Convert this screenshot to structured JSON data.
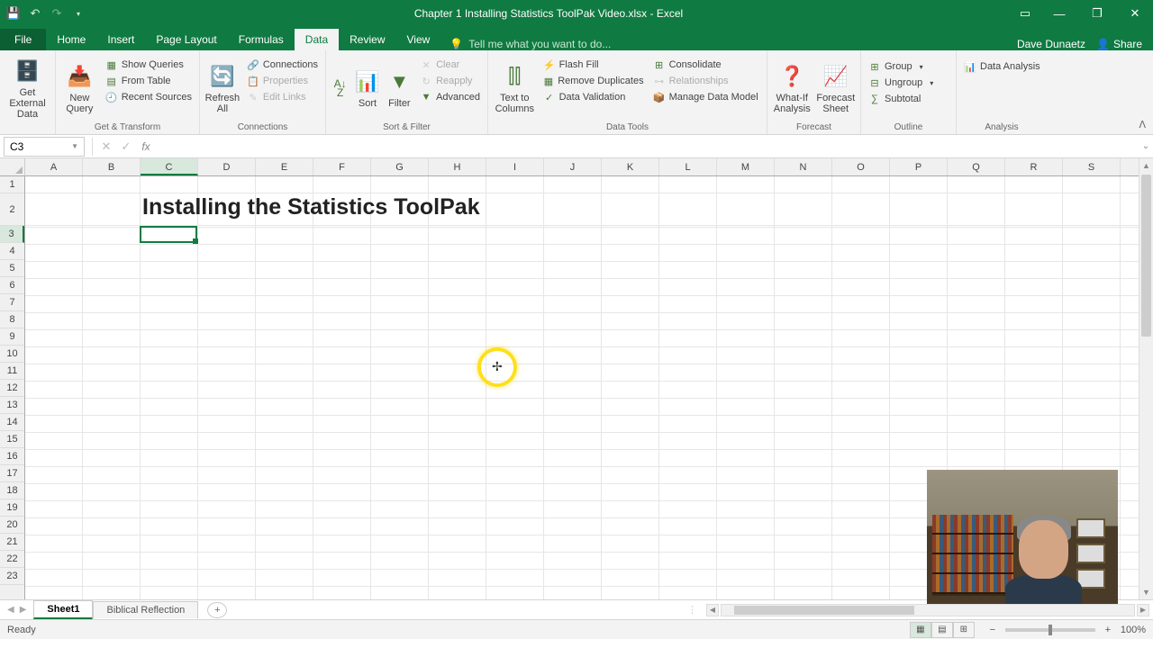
{
  "title": "Chapter 1 Installing Statistics ToolPak Video.xlsx - Excel",
  "user": "Dave Dunaetz",
  "share": "Share",
  "tabs": {
    "file": "File",
    "home": "Home",
    "insert": "Insert",
    "pagelayout": "Page Layout",
    "formulas": "Formulas",
    "data": "Data",
    "review": "Review",
    "view": "View"
  },
  "tellme": "Tell me what you want to do...",
  "ribbon": {
    "getexternal": {
      "label": "Get External Data",
      "btn": "Get External\nData"
    },
    "gettransform": {
      "label": "Get & Transform",
      "newquery": "New\nQuery",
      "showqueries": "Show Queries",
      "fromtable": "From Table",
      "recentsources": "Recent Sources"
    },
    "connections": {
      "label": "Connections",
      "refreshall": "Refresh\nAll",
      "connections": "Connections",
      "properties": "Properties",
      "editlinks": "Edit Links"
    },
    "sortfilter": {
      "label": "Sort & Filter",
      "sort": "Sort",
      "filter": "Filter",
      "clear": "Clear",
      "reapply": "Reapply",
      "advanced": "Advanced"
    },
    "datatools": {
      "label": "Data Tools",
      "texttocolumns": "Text to\nColumns",
      "flashfill": "Flash Fill",
      "removedup": "Remove Duplicates",
      "datavalidation": "Data Validation",
      "consolidate": "Consolidate",
      "relationships": "Relationships",
      "managedatamodel": "Manage Data Model"
    },
    "forecast": {
      "label": "Forecast",
      "whatif": "What-If\nAnalysis",
      "forecastsheet": "Forecast\nSheet"
    },
    "outline": {
      "label": "Outline",
      "group": "Group",
      "ungroup": "Ungroup",
      "subtotal": "Subtotal"
    },
    "analysis": {
      "label": "Analysis",
      "dataanalysis": "Data Analysis"
    }
  },
  "namebox": "C3",
  "columns": [
    "A",
    "B",
    "C",
    "D",
    "E",
    "F",
    "G",
    "H",
    "I",
    "J",
    "K",
    "L",
    "M",
    "N",
    "O",
    "P",
    "Q",
    "R",
    "S"
  ],
  "rows": [
    "1",
    "2",
    "3",
    "4",
    "5",
    "6",
    "7",
    "8",
    "9",
    "10",
    "11",
    "12",
    "13",
    "14",
    "15",
    "16",
    "17",
    "18",
    "19",
    "20",
    "21",
    "22",
    "23"
  ],
  "celltext": "Installing the Statistics ToolPak",
  "sheets": {
    "active": "Sheet1",
    "other": "Biblical Reflection"
  },
  "status": {
    "ready": "Ready",
    "zoom": "100%"
  }
}
